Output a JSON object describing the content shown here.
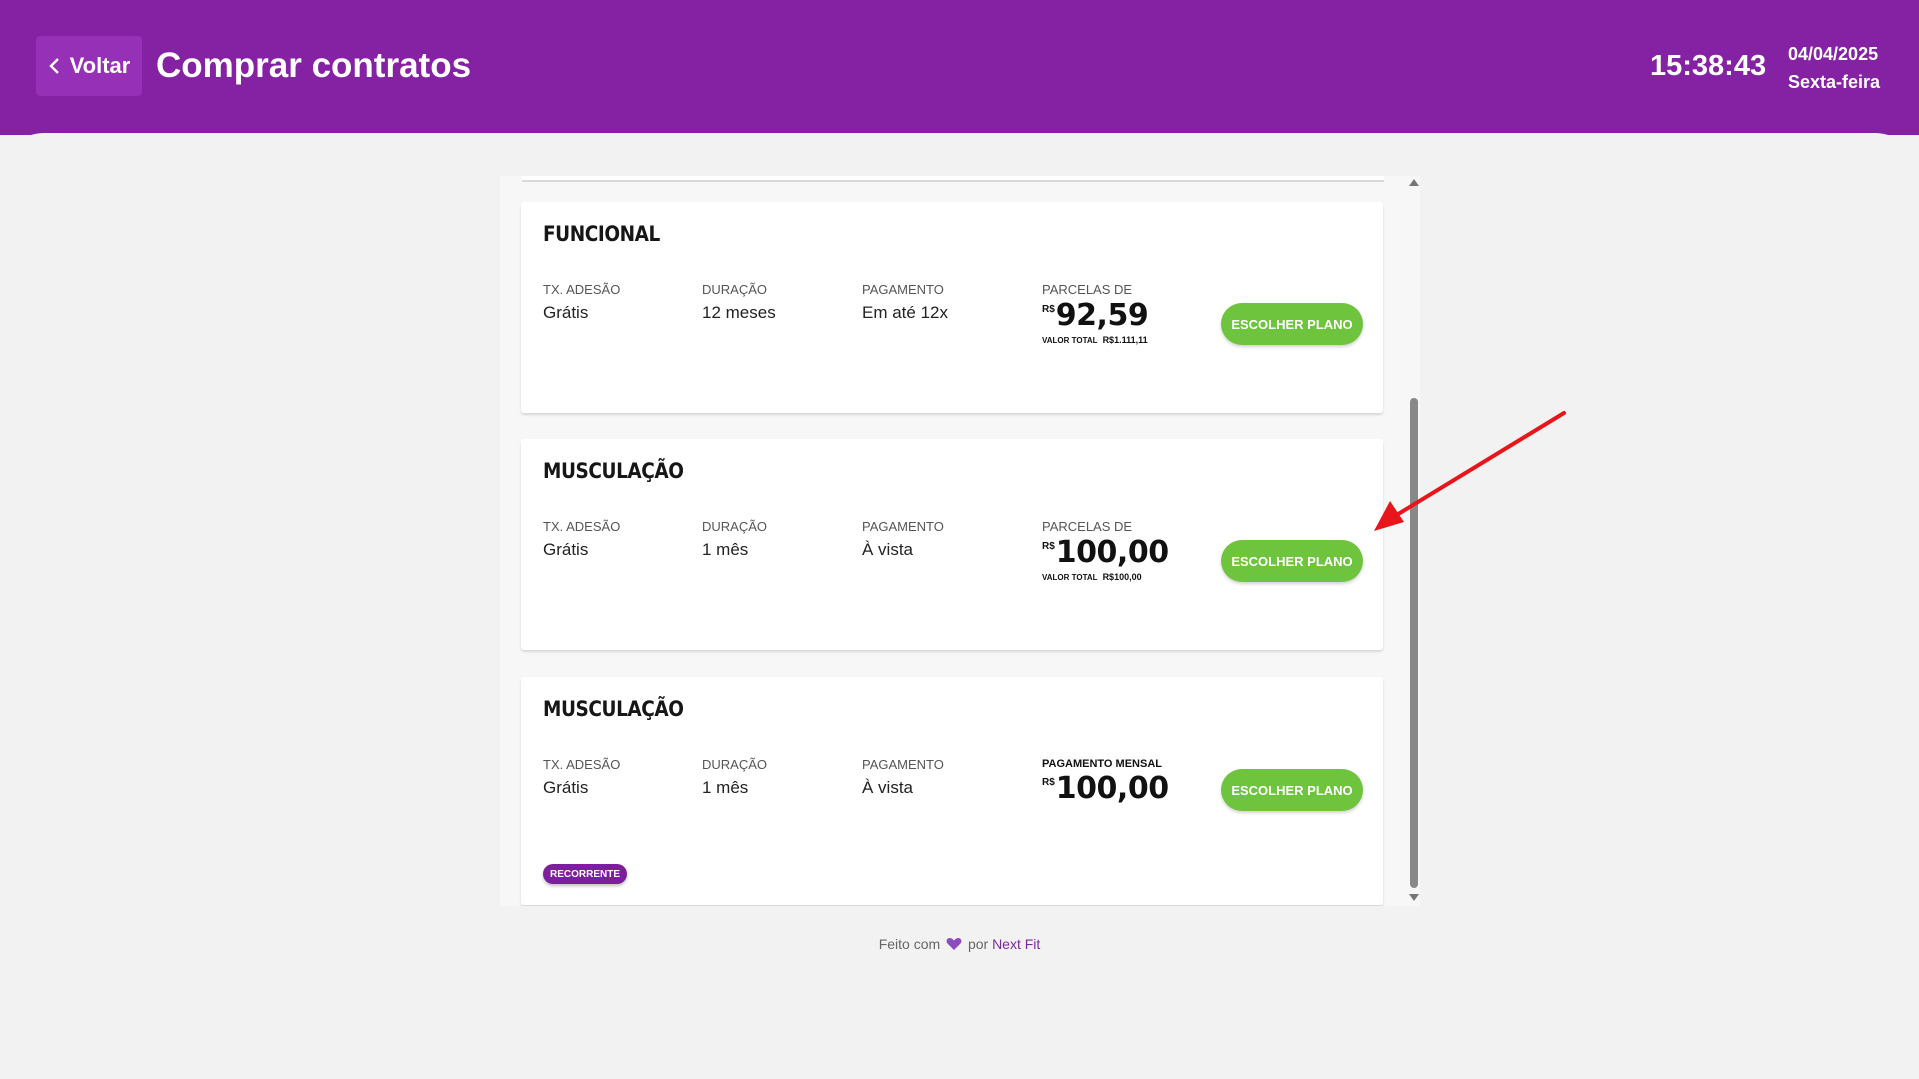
{
  "header": {
    "back_label": "Voltar",
    "title": "Comprar contratos",
    "time": "15:38:43",
    "date": "04/04/2025",
    "weekday": "Sexta-feira"
  },
  "labels": {
    "adhesion": "TX. ADESÃO",
    "duration": "DURAÇÃO",
    "payment": "PAGAMENTO",
    "installments": "PARCELAS DE",
    "monthly_payment": "PAGAMENTO MENSAL",
    "total_value": "VALOR TOTAL",
    "currency": "R$",
    "choose_plan": "ESCOLHER PLANO"
  },
  "plans": [
    {
      "name": "FUNCIONAL",
      "adhesion": "Grátis",
      "duration": "12 meses",
      "payment": "Em até 12x",
      "price": "92,59",
      "total": "R$1.111,11"
    },
    {
      "name": "MUSCULAÇÃO",
      "adhesion": "Grátis",
      "duration": "1 mês",
      "payment": "À vista",
      "price": "100,00",
      "total": "R$100,00"
    },
    {
      "name": "MUSCULAÇÃO",
      "adhesion": "Grátis",
      "duration": "1 mês",
      "payment": "À vista",
      "price": "100,00",
      "badge": "RECORRENTE"
    }
  ],
  "footer": {
    "made_with": "Feito com",
    "by": "por",
    "brand": "Next Fit"
  },
  "colors": {
    "header": "#8422a3",
    "button_green": "#6ec43d",
    "badge_purple": "#7c1f9c",
    "annotation_arrow": "#e8161b"
  },
  "icons": {
    "back": "chevron-left-icon",
    "heart": "heart-icon"
  }
}
